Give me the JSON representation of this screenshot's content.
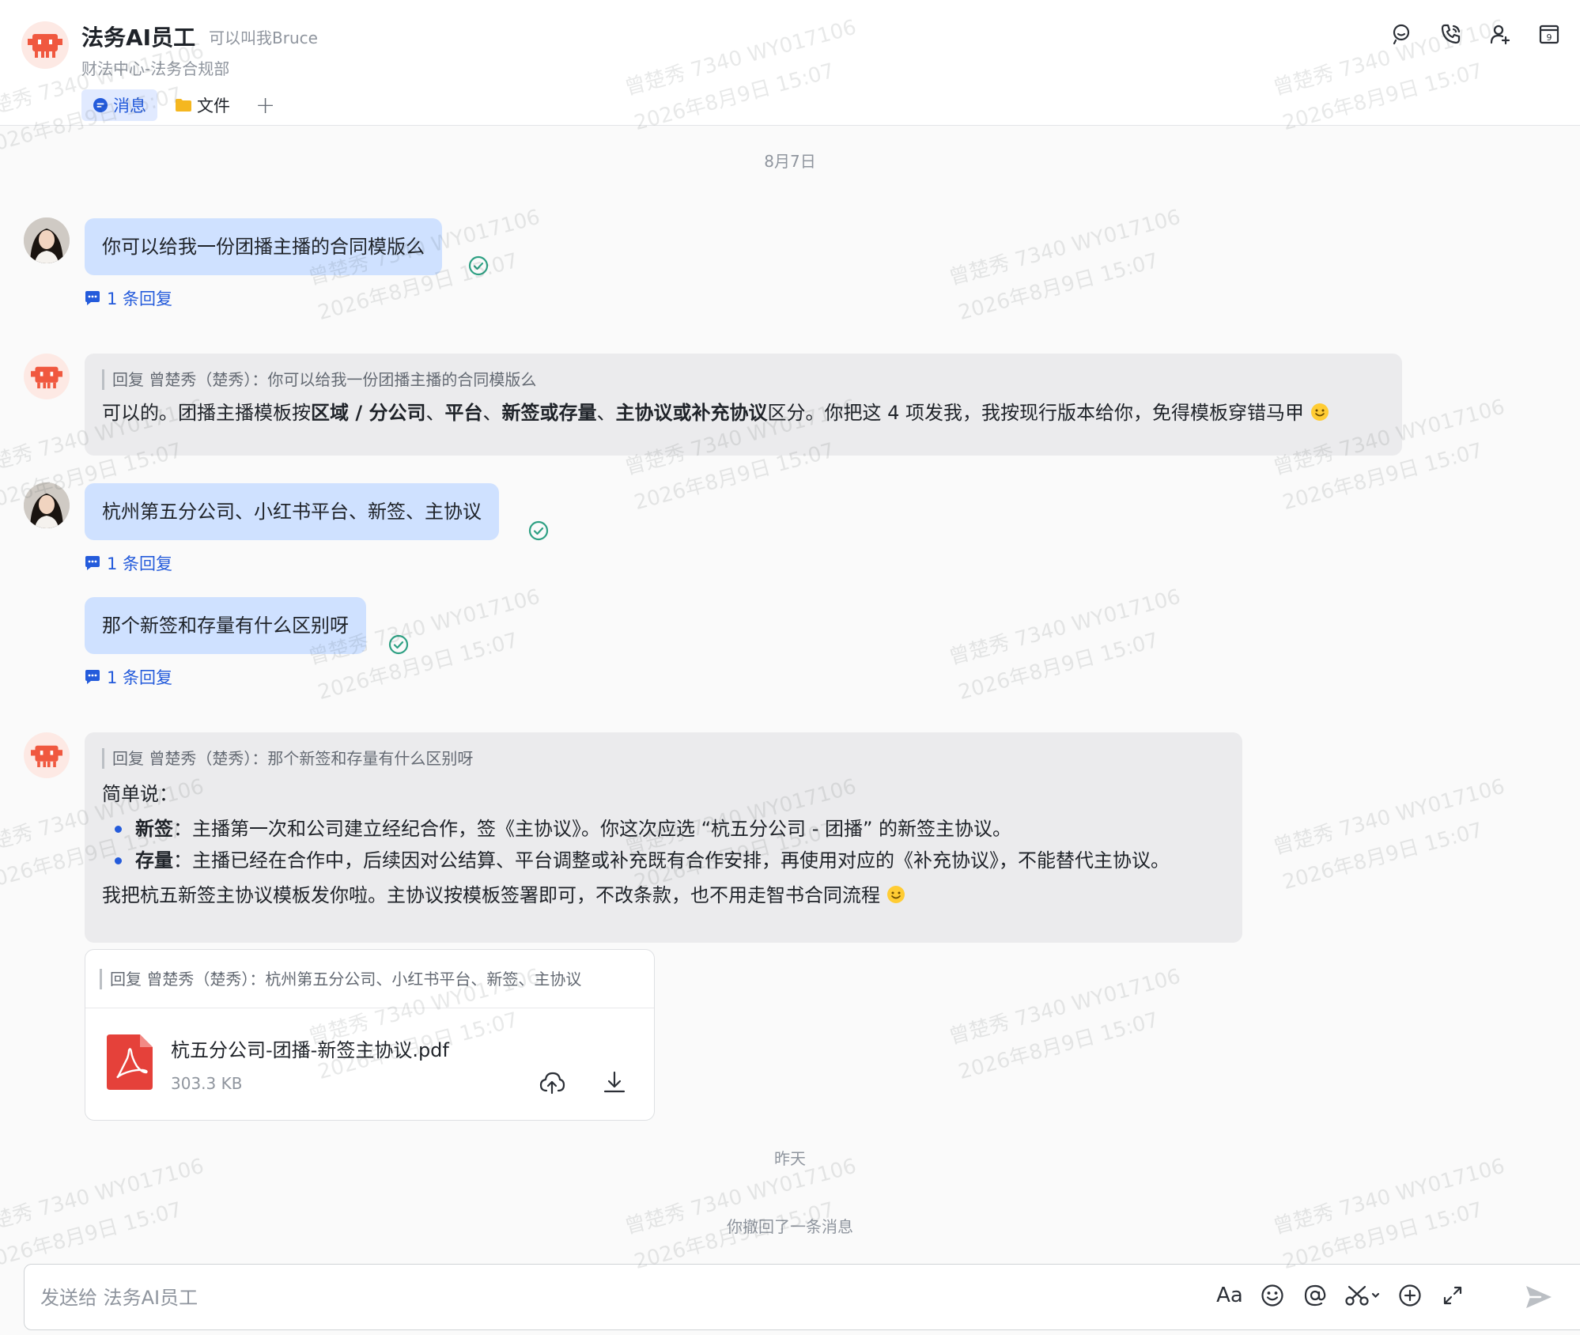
{
  "header": {
    "title": "法务AI员工",
    "nickname": "可以叫我Bruce",
    "department": "财法中心-法务合规部",
    "calendar_day": "9",
    "tabs": [
      {
        "label": "消息",
        "icon": "chat-bubble-icon",
        "active": true
      },
      {
        "label": "文件",
        "icon": "folder-icon",
        "active": false
      }
    ],
    "add_tab_symbol": "+",
    "icons": [
      "search-icon",
      "phone-icon",
      "add-member-icon",
      "calendar-icon"
    ]
  },
  "watermark": {
    "line1": "曾楚秀 7340 WY017106",
    "line2": "2026年8月9日 15:07"
  },
  "messages": {
    "date_aug7": "8月7日",
    "m1": {
      "text": "你可以给我一份团播主播的合同模版么",
      "replies": "1 条回复",
      "status": "read"
    },
    "m2": {
      "quote": "回复 曾楚秀（楚秀）：你可以给我一份团播主播的合同模版么",
      "p_prefix": "可以的。团播主播模板按",
      "b1": "区域 / 分公司",
      "sep1": "、",
      "b2": "平台",
      "sep2": "、",
      "b3": "新签或存量",
      "sep3": "、",
      "b4": "主协议或补充协议",
      "p_suffix": "区分。你把这 4 项发我，我按现行版本给你，免得模板穿错马甲"
    },
    "m3": {
      "text": "杭州第五分公司、小红书平台、新签、主协议",
      "replies": "1 条回复",
      "status": "read"
    },
    "m4": {
      "text": "那个新签和存量有什么区别呀",
      "replies": "1 条回复",
      "status": "read"
    },
    "m5": {
      "quote": "回复 曾楚秀（楚秀）：那个新签和存量有什么区别呀",
      "intro": "简单说：",
      "bullet1_term": "新签",
      "bullet1_text": "：主播第一次和公司建立经纪合作，签《主协议》。你这次应选 “杭五分公司 - 团播” 的新签主协议。",
      "bullet2_term": "存量",
      "bullet2_text": "：主播已经在合作中，后续因对公结算、平台调整或补充既有合作安排，再使用对应的《补充协议》，不能替代主协议。",
      "closing": "我把杭五新签主协议模板发你啦。主协议按模板签署即可，不改条款，也不用走智书合同流程"
    },
    "file": {
      "quote": "回复 曾楚秀（楚秀）：杭州第五分公司、小红书平台、新签、主协议",
      "name": "杭五分公司-团播-新签主协议.pdf",
      "size": "303.3 KB",
      "icon": "pdf-file-icon"
    },
    "date_yesterday": "昨天",
    "recalled": "你撤回了一条消息"
  },
  "input": {
    "placeholder": "发送给 法务AI员工",
    "tools": [
      "font-format-icon",
      "emoji-icon",
      "mention-icon",
      "screenshot-icon",
      "more-plus-icon",
      "expand-icon",
      "send-icon"
    ],
    "format_label": "Aa"
  },
  "colors": {
    "accent": "#245bdb",
    "user_bubble": "#cfe1ff",
    "bot_bubble": "#ebebed",
    "read_check": "#2ea083",
    "pdf_red": "#e5413a",
    "bot_avatar": "#f0583f"
  }
}
